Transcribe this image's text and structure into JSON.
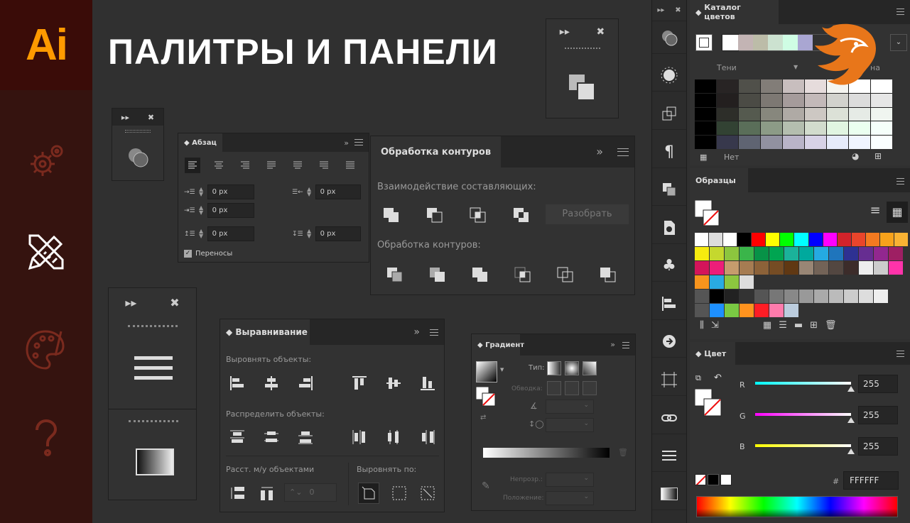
{
  "app_logo": "Ai",
  "title": "ПАЛИТРЫ И ПАНЕЛИ",
  "sidebar": {
    "icons": [
      "gear-icon",
      "tools-icon",
      "palette-icon",
      "help-icon"
    ]
  },
  "paragraph_panel": {
    "tab": "Абзац",
    "indent_left": "0 px",
    "indent_right": "0 px",
    "indent_first": "0 px",
    "space_before": "0 px",
    "space_after": "0 px",
    "hyphenation": "Переносы"
  },
  "pathfinder_panel": {
    "tab": "Обработка контуров",
    "shape_modes_label": "Взаимодействие составляющих:",
    "expand_button": "Разобрать",
    "pathfinders_label": "Обработка контуров:"
  },
  "align_panel": {
    "tab": "Выравнивание",
    "align_objects_label": "Выровнять объекты:",
    "distribute_objects_label": "Распределить объекты:",
    "distribute_spacing_label": "Расст. м/у объектами",
    "align_to_label": "Выровнять по:",
    "spacing_value": "0"
  },
  "gradient_panel": {
    "tab": "Градиент",
    "type_label": "Тип:",
    "stroke_label": "Обводка:",
    "opacity_label": "Непрозр.:",
    "location_label": "Положение:"
  },
  "color_guide_panel": {
    "tab": "Каталог цветов",
    "variation_left": "Тени",
    "variation_right": "на",
    "footer_label": "Нет"
  },
  "swatches_panel": {
    "tab": "Образцы"
  },
  "color_panel": {
    "tab": "Цвет",
    "r_label": "R",
    "g_label": "G",
    "b_label": "B",
    "r_value": "255",
    "g_value": "255",
    "b_value": "255",
    "hex_label": "#",
    "hex_value": "FFFFFF"
  },
  "colors": {
    "accent": "#ff9a00",
    "sidebar_bg": "#35130f",
    "panel_bg": "#323232"
  }
}
